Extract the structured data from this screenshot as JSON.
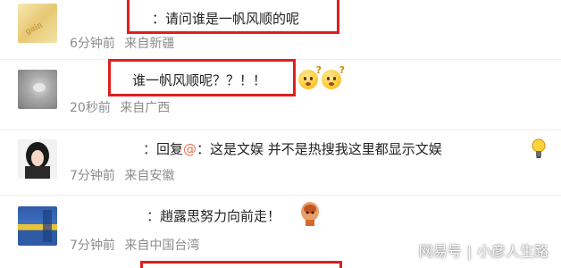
{
  "comments": [
    {
      "username": "",
      "text": "：请问谁是一帆风顺的呢",
      "time": "6分钟前",
      "location": "来自新疆"
    },
    {
      "username": "",
      "text": "谁一帆风顺呢？？！！",
      "time": "20秒前",
      "location": "来自广西"
    },
    {
      "username": "",
      "username_colon": "：",
      "reply_prefix": "回复",
      "reply_at": "@",
      "reply_target": "",
      "reply_text": "：这是文娱 并不是热搜我这里都显示文娱",
      "time": "7分钟前",
      "location": "来自安徽"
    },
    {
      "username": "",
      "username_colon": "：",
      "text": "趙露思努力向前走！",
      "time": "7分钟前",
      "location": "来自中国台湾"
    }
  ],
  "watermark": {
    "brand": "网易号",
    "separator": "|",
    "author": "小彦人生路"
  },
  "colors": {
    "highlight_box": "#e01e1e",
    "username": "#eb7350",
    "meta": "#8c8c8c"
  }
}
